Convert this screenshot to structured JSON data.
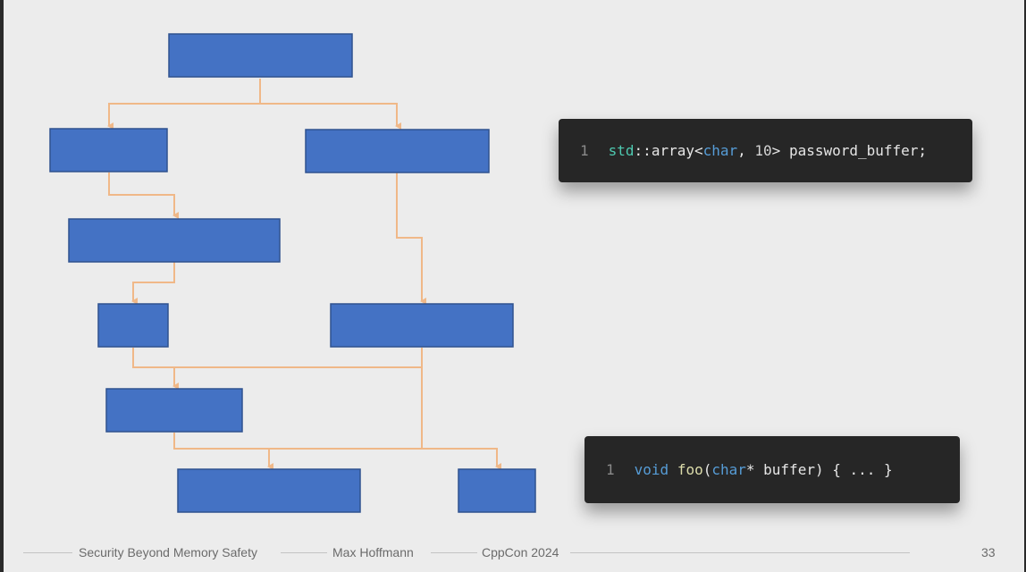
{
  "code_snippets": [
    {
      "line_number": "1",
      "tokens": [
        {
          "text": "std",
          "cls": "c-ns"
        },
        {
          "text": "::array<",
          "cls": "c-plain"
        },
        {
          "text": "char",
          "cls": "c-kw"
        },
        {
          "text": ", ",
          "cls": "c-plain"
        },
        {
          "text": "10",
          "cls": "c-num"
        },
        {
          "text": "> password_buffer;",
          "cls": "c-plain"
        }
      ]
    },
    {
      "line_number": "1",
      "tokens": [
        {
          "text": "void",
          "cls": "c-kw"
        },
        {
          "text": " ",
          "cls": "c-plain"
        },
        {
          "text": "foo",
          "cls": "c-fn"
        },
        {
          "text": "(",
          "cls": "c-plain"
        },
        {
          "text": "char",
          "cls": "c-kw"
        },
        {
          "text": "* buffer) { ... }",
          "cls": "c-plain"
        }
      ]
    }
  ],
  "footer": {
    "talk_title": "Security Beyond Memory Safety",
    "speaker": "Max Hoffmann",
    "event": "CppCon 2024",
    "slide_number": "33"
  },
  "colors": {
    "node_fill": "#4472c4",
    "edge": "#f0b888",
    "code_bg": "#262626"
  }
}
